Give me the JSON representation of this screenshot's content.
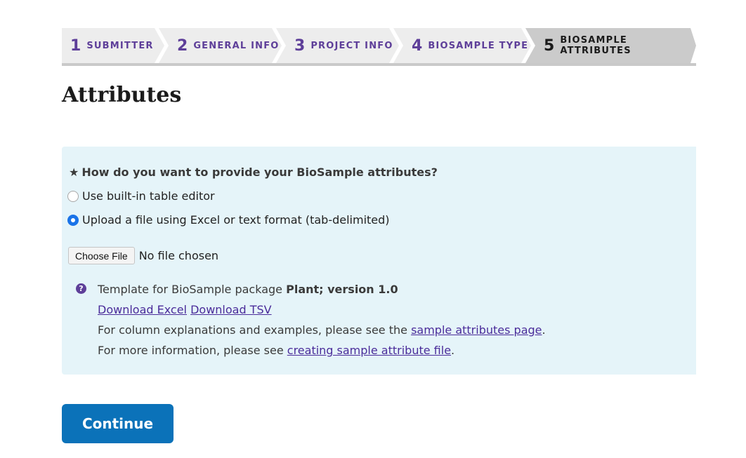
{
  "steps": [
    {
      "num": "1",
      "label": "SUBMITTER"
    },
    {
      "num": "2",
      "label": "GENERAL INFO"
    },
    {
      "num": "3",
      "label": "PROJECT INFO"
    },
    {
      "num": "4",
      "label": "BIOSAMPLE TYPE"
    },
    {
      "num": "5",
      "label": "BIOSAMPLE ATTRIBUTES"
    }
  ],
  "page_title": "Attributes",
  "question": {
    "required_mark": "★",
    "text": "How do you want to provide your BioSample attributes?"
  },
  "options": [
    {
      "label": "Use built-in table editor",
      "selected": false
    },
    {
      "label": "Upload a file using Excel or text format (tab-delimited)",
      "selected": true
    }
  ],
  "file": {
    "button_label": "Choose File",
    "status": "No file chosen"
  },
  "template": {
    "icon": "question-icon",
    "prefix": "Template for BioSample package ",
    "package": "Plant; version 1.0",
    "download_excel": "Download Excel",
    "download_tsv": "Download TSV",
    "column_text": "For column explanations and examples, please see the ",
    "column_link": "sample attributes page",
    "column_suffix": ".",
    "more_text": "For more information, please see ",
    "more_link": "creating sample attribute file",
    "more_suffix": "."
  },
  "continue_label": "Continue"
}
